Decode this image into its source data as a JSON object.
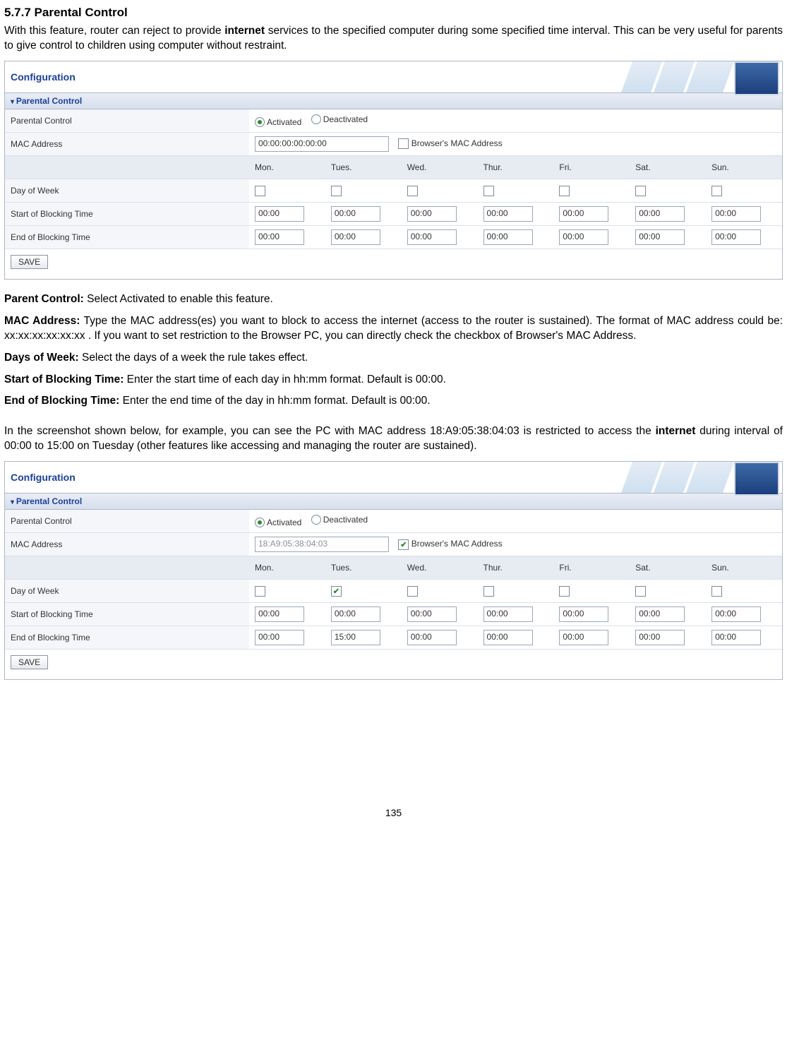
{
  "heading": "5.7.7 Parental Control",
  "intro_1a": "With this feature, router can reject to provide ",
  "intro_bold1": "internet",
  "intro_1b": " services to the specified computer during some specified time interval. This can be very useful for parents to give control to children using computer without restraint.",
  "panel_common": {
    "config_title": "Configuration",
    "section_title": "Parental Control",
    "row_pc": "Parental Control",
    "row_mac": "MAC Address",
    "row_dow": "Day of Week",
    "row_start": "Start of Blocking Time",
    "row_end": "End of Blocking Time",
    "radio_act": "Activated",
    "radio_deact": "Deactivated",
    "browser_mac": "Browser's MAC Address",
    "days": [
      "Mon.",
      "Tues.",
      "Wed.",
      "Thur.",
      "Fri.",
      "Sat.",
      "Sun."
    ],
    "btn_save": "SAVE"
  },
  "panel1": {
    "mac_value": "00:00:00:00:00:00",
    "browser_checked": false,
    "day_checked": [
      false,
      false,
      false,
      false,
      false,
      false,
      false
    ],
    "start": [
      "00:00",
      "00:00",
      "00:00",
      "00:00",
      "00:00",
      "00:00",
      "00:00"
    ],
    "end": [
      "00:00",
      "00:00",
      "00:00",
      "00:00",
      "00:00",
      "00:00",
      "00:00"
    ]
  },
  "para_pc_label": "Parent Control:",
  "para_pc_text": " Select Activated to enable this feature.",
  "para_mac_label": "MAC Address:",
  "para_mac_text": " Type the MAC address(es) you want to block to access the internet (access to the router is sustained). The format of MAC address could be: xx:xx:xx:xx:xx:xx . If you want to set restriction to the Browser PC, you can directly check the checkbox of Browser's MAC Address.",
  "para_dow_label": "Days of Week:",
  "para_dow_text": " Select the days of a week the rule takes effect.",
  "para_start_label": "Start of Blocking Time:",
  "para_start_text": " Enter the start time of each day in hh:mm format. Default is 00:00.",
  "para_end_label": "End of Blocking Time:",
  "para_end_text": " Enter the end time of the day in hh:mm format. Default is 00:00.",
  "example_a": "In the screenshot shown below, for example, you can see the PC with MAC address 18:A9:05:38:04:03 is restricted to access the ",
  "example_bold": "internet",
  "example_b": " during interval of 00:00 to 15:00 on Tuesday (other features like accessing and managing the router are sustained).",
  "panel2": {
    "mac_value": "18:A9:05:38:04:03",
    "browser_checked": true,
    "day_checked": [
      false,
      true,
      false,
      false,
      false,
      false,
      false
    ],
    "start": [
      "00:00",
      "00:00",
      "00:00",
      "00:00",
      "00:00",
      "00:00",
      "00:00"
    ],
    "end": [
      "00:00",
      "15:00",
      "00:00",
      "00:00",
      "00:00",
      "00:00",
      "00:00"
    ]
  },
  "page_number": "135"
}
